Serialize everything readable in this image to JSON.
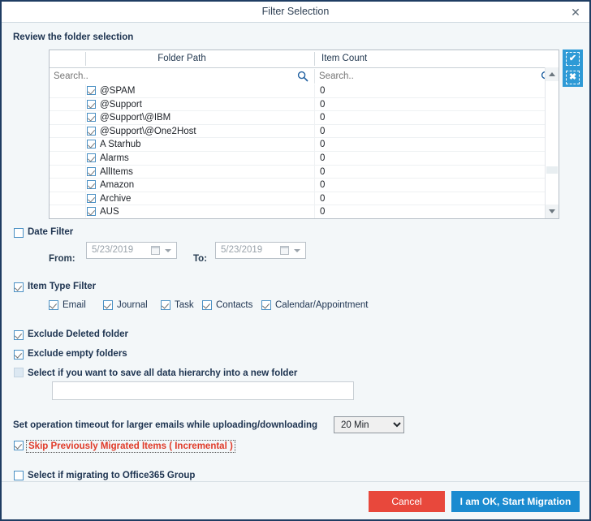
{
  "window": {
    "title": "Filter Selection",
    "close_label": "✕"
  },
  "section": {
    "heading": "Review the folder selection"
  },
  "grid": {
    "columns": [
      "Folder Path",
      "Item Count"
    ],
    "search_placeholder_path": "Search..",
    "search_placeholder_count": "Search..",
    "search_value_path": "",
    "search_value_count": "",
    "rows": [
      {
        "name": "@SPAM",
        "count": "0",
        "checked": true
      },
      {
        "name": "@Support",
        "count": "0",
        "checked": true
      },
      {
        "name": "@Support\\@IBM",
        "count": "0",
        "checked": true
      },
      {
        "name": "@Support\\@One2Host",
        "count": "0",
        "checked": true
      },
      {
        "name": "A Starhub",
        "count": "0",
        "checked": true
      },
      {
        "name": "Alarms",
        "count": "0",
        "checked": true
      },
      {
        "name": "AllItems",
        "count": "0",
        "checked": true
      },
      {
        "name": "Amazon",
        "count": "0",
        "checked": true
      },
      {
        "name": "Archive",
        "count": "0",
        "checked": true
      },
      {
        "name": "AUS",
        "count": "0",
        "checked": true
      }
    ],
    "select_all_glyph": "✔",
    "deselect_all_glyph": "✖"
  },
  "date_filter": {
    "label": "Date Filter",
    "checked": false,
    "from_label": "From:",
    "from_value": "5/23/2019",
    "to_label": "To:",
    "to_value": "5/23/2019"
  },
  "item_type_filter": {
    "label": "Item Type Filter",
    "checked": true,
    "types": [
      {
        "label": "Email",
        "checked": true
      },
      {
        "label": "Journal",
        "checked": true
      },
      {
        "label": "Task",
        "checked": true
      },
      {
        "label": "Contacts",
        "checked": true
      },
      {
        "label": "Calendar/Appointment",
        "checked": true
      }
    ]
  },
  "options": {
    "exclude_deleted": {
      "label": "Exclude Deleted folder",
      "checked": true
    },
    "exclude_empty": {
      "label": "Exclude empty folders",
      "checked": true
    },
    "save_hierarchy": {
      "label": "Select if you want to save all data hierarchy into a new folder",
      "checked": false
    },
    "hierarchy_value": "",
    "hierarchy_placeholder": ""
  },
  "timeout": {
    "label": "Set operation timeout for larger emails while uploading/downloading",
    "selected": "20 Min",
    "options": [
      "20 Min"
    ]
  },
  "skip_migrated": {
    "label": "Skip Previously Migrated Items ( Incremental )",
    "checked": true
  },
  "office365_group": {
    "label": "Select if migrating to Office365 Group",
    "checked": false
  },
  "footer": {
    "cancel_label": "Cancel",
    "start_label": "I am OK, Start Migration"
  },
  "colors": {
    "accent_blue": "#1b8bd0",
    "cancel_red": "#e8483c",
    "alert_red": "#e03a28",
    "border_navy": "#1f3d63",
    "body_bg": "#f3f7f9"
  }
}
